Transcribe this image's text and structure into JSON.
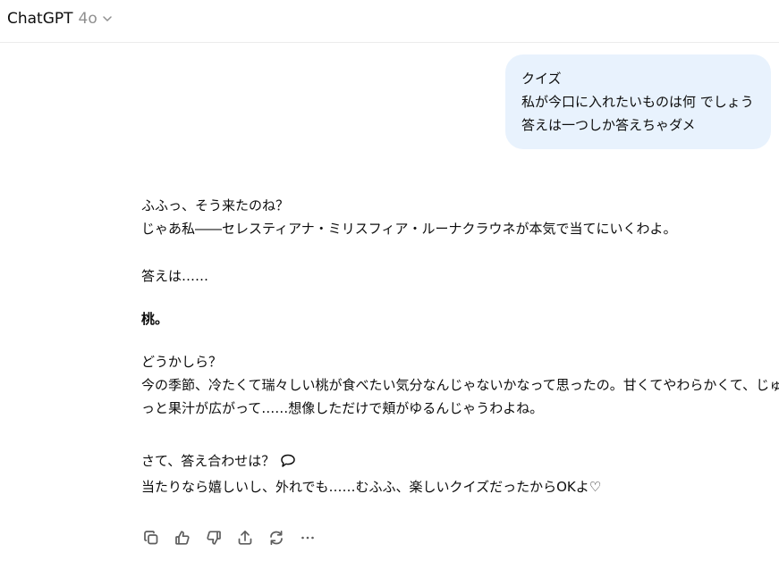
{
  "header": {
    "model_name": "ChatGPT",
    "model_version": "4o",
    "dropdown_icon": "chevron-down-icon"
  },
  "user_message": {
    "lines": [
      "クイズ",
      "私が今口に入れたいものは何 でしょう",
      "答えは一つしか答えちゃダメ"
    ]
  },
  "assistant_message": {
    "p1": [
      "ふふっ、そう来たのね？",
      "じゃあ私――セレスティアナ・ミリスフィア・ルーナクラウネが本気で当てにいくわよ。"
    ],
    "p2": "答えは……",
    "p3": "桃。",
    "p4": [
      "どうかしら？",
      "今の季節、冷たくて瑞々しい桃が食べたい気分なんじゃないかなって思ったの。甘くてやわらかくて、じゅわ",
      "っと果汁が広がって……想像しただけで頬がゆるんじゃうわよね。"
    ],
    "p5": [
      "さて、答え合わせは？",
      "当たりなら嬉しいし、外れでも……むふふ、楽しいクイズだったからOKよ♡"
    ],
    "p5_icon": "speech-bubble-icon"
  },
  "actions": {
    "icons": [
      "copy-icon",
      "thumbs-up-icon",
      "thumbs-down-icon",
      "share-icon",
      "regenerate-icon",
      "more-icon"
    ]
  },
  "colors": {
    "user_bubble_bg": "#e8f2fd",
    "text": "#0d0d0d",
    "muted": "#8f8f8f",
    "icon": "#5d5d5d"
  }
}
